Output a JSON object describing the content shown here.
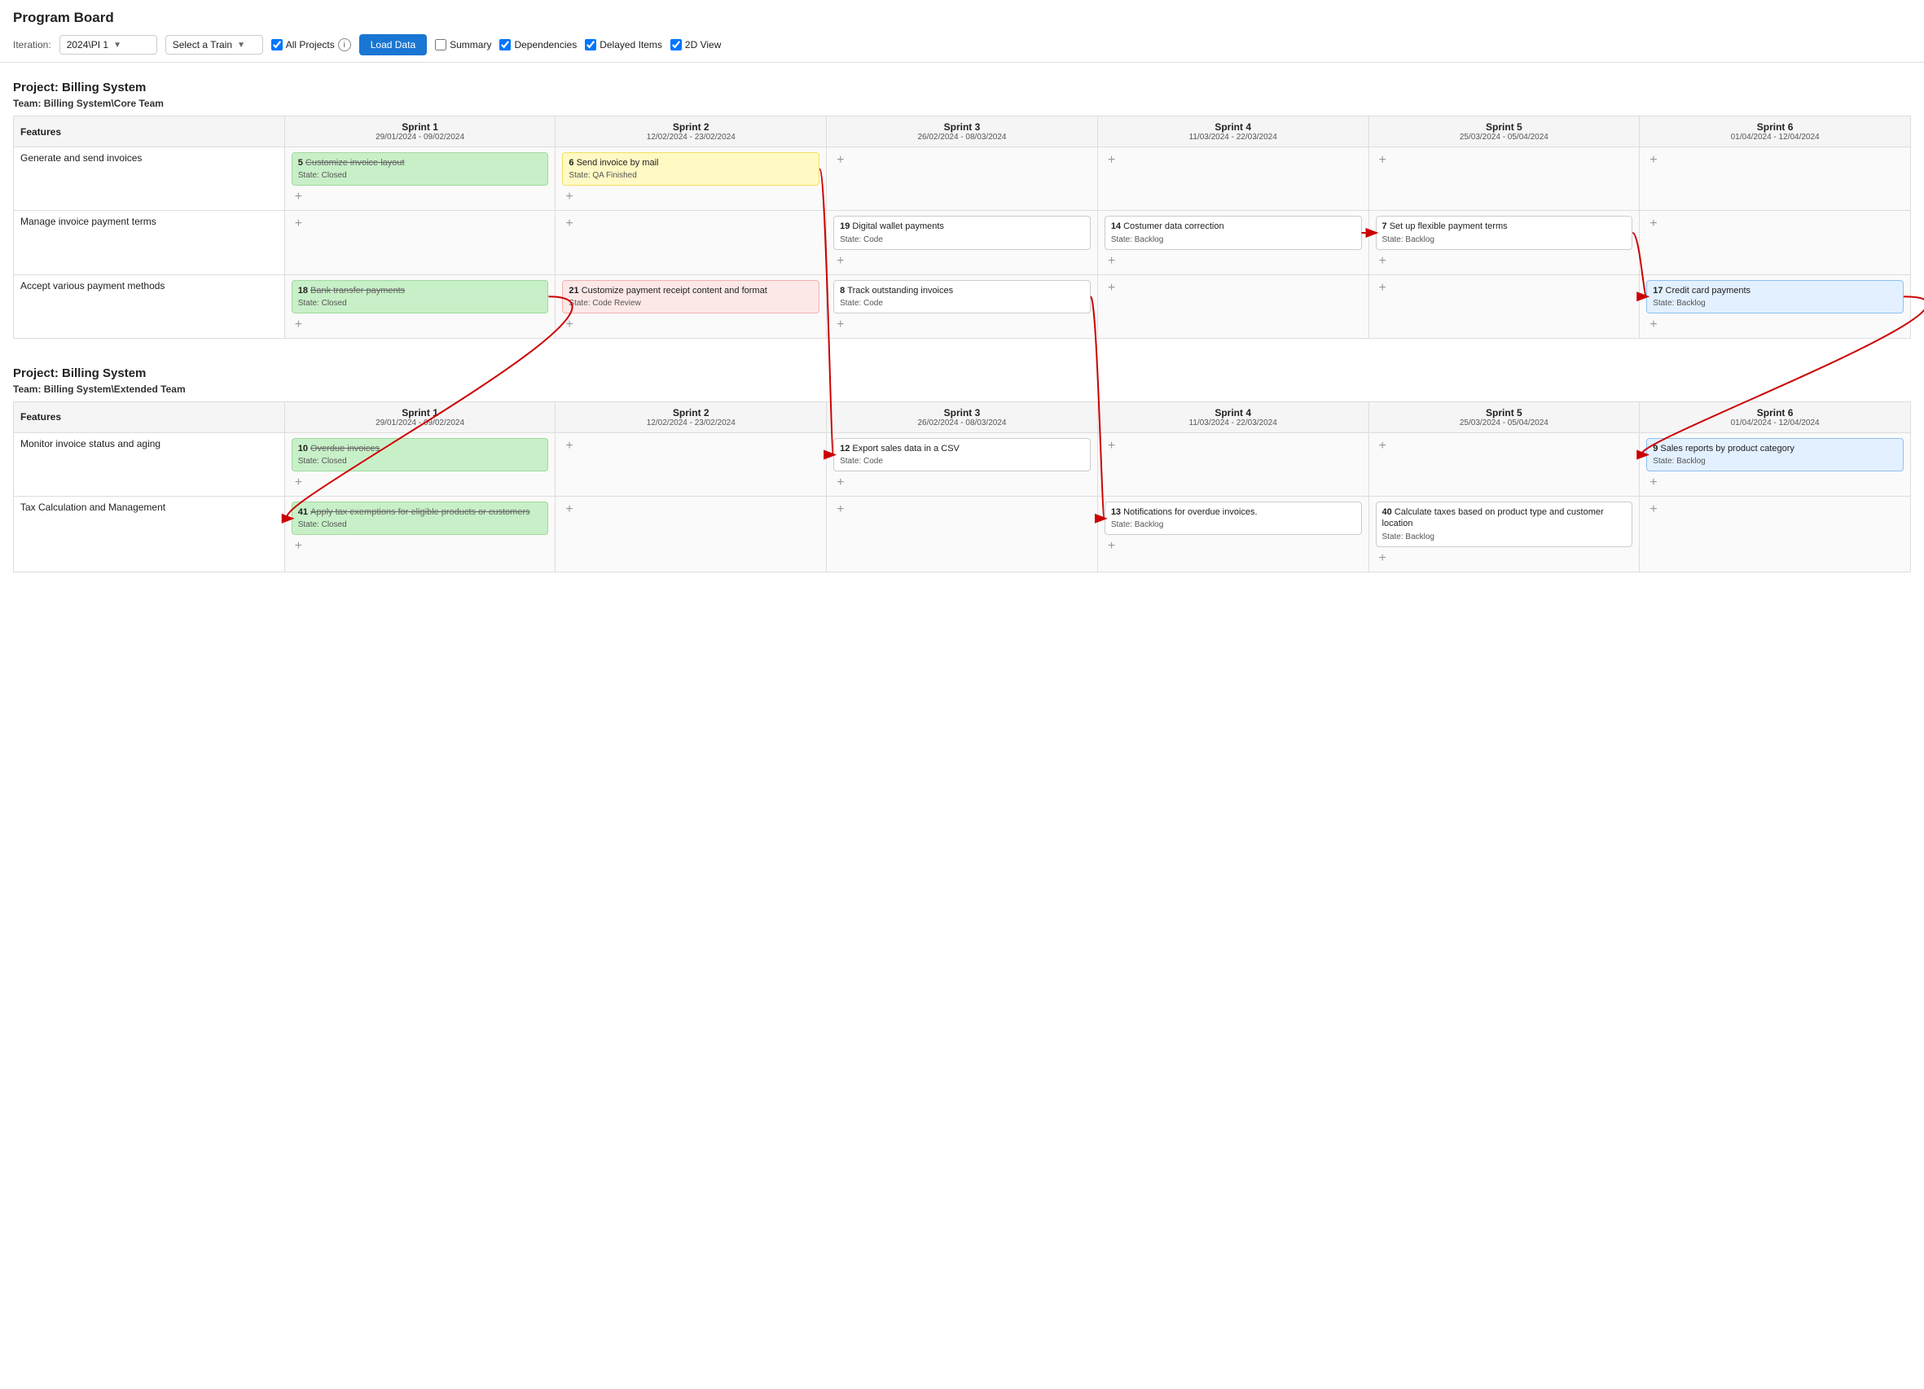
{
  "header": {
    "title": "Program Board",
    "iteration_label": "Iteration:",
    "iteration_value": "2024\\PI 1",
    "select_train_placeholder": "Select a Train",
    "all_projects_label": "All Projects",
    "load_data_label": "Load Data",
    "summary_label": "Summary",
    "dependencies_label": "Dependencies",
    "delayed_items_label": "Delayed Items",
    "two_d_view_label": "2D View"
  },
  "projects": [
    {
      "title": "Project: Billing System",
      "team": "Team: Billing System\\Core Team",
      "sprints": [
        {
          "name": "Sprint 1",
          "dates": "29/01/2024 - 09/02/2024"
        },
        {
          "name": "Sprint 2",
          "dates": "12/02/2024 - 23/02/2024"
        },
        {
          "name": "Sprint 3",
          "dates": "26/02/2024 - 08/03/2024"
        },
        {
          "name": "Sprint 4",
          "dates": "11/03/2024 - 22/03/2024"
        },
        {
          "name": "Sprint 5",
          "dates": "25/03/2024 - 05/04/2024"
        },
        {
          "name": "Sprint 6",
          "dates": "01/04/2024 - 12/04/2024"
        }
      ],
      "features": [
        {
          "name": "Generate and send invoices",
          "cards": [
            {
              "sprint": 0,
              "id": "5",
              "title": "Customize invoice layout",
              "state": "Closed",
              "color": "green",
              "strikethrough": true
            },
            {
              "sprint": 1,
              "id": "6",
              "title": "Send invoice by mail",
              "state": "QA Finished",
              "color": "yellow",
              "strikethrough": false
            }
          ]
        },
        {
          "name": "Manage invoice payment terms",
          "cards": [
            {
              "sprint": 2,
              "id": "19",
              "title": "Digital wallet payments",
              "state": "Code",
              "color": "white",
              "strikethrough": false
            },
            {
              "sprint": 3,
              "id": "14",
              "title": "Costumer data correction",
              "state": "Backlog",
              "color": "white",
              "strikethrough": false
            },
            {
              "sprint": 4,
              "id": "7",
              "title": "Set up flexible payment terms",
              "state": "Backlog",
              "color": "white",
              "strikethrough": false
            }
          ]
        },
        {
          "name": "Accept various payment methods",
          "cards": [
            {
              "sprint": 0,
              "id": "18",
              "title": "Bank transfer payments",
              "state": "Closed",
              "color": "green",
              "strikethrough": true
            },
            {
              "sprint": 1,
              "id": "21",
              "title": "Customize payment receipt content and format",
              "state": "Code Review",
              "color": "pink",
              "strikethrough": false
            },
            {
              "sprint": 2,
              "id": "8",
              "title": "Track outstanding invoices",
              "state": "Code",
              "color": "white",
              "strikethrough": false
            },
            {
              "sprint": 5,
              "id": "17",
              "title": "Credit card payments",
              "state": "Backlog",
              "color": "blue",
              "strikethrough": false
            }
          ]
        }
      ]
    },
    {
      "title": "Project: Billing System",
      "team": "Team: Billing System\\Extended Team",
      "sprints": [
        {
          "name": "Sprint 1",
          "dates": "29/01/2024 - 09/02/2024"
        },
        {
          "name": "Sprint 2",
          "dates": "12/02/2024 - 23/02/2024"
        },
        {
          "name": "Sprint 3",
          "dates": "26/02/2024 - 08/03/2024"
        },
        {
          "name": "Sprint 4",
          "dates": "11/03/2024 - 22/03/2024"
        },
        {
          "name": "Sprint 5",
          "dates": "25/03/2024 - 05/04/2024"
        },
        {
          "name": "Sprint 6",
          "dates": "01/04/2024 - 12/04/2024"
        }
      ],
      "features": [
        {
          "name": "Monitor invoice status and aging",
          "cards": [
            {
              "sprint": 0,
              "id": "10",
              "title": "Overdue invoices",
              "state": "Closed",
              "color": "green",
              "strikethrough": true
            },
            {
              "sprint": 2,
              "id": "12",
              "title": "Export sales data in a CSV",
              "state": "Code",
              "color": "white",
              "strikethrough": false
            },
            {
              "sprint": 5,
              "id": "9",
              "title": "Sales reports by product category",
              "state": "Backlog",
              "color": "blue",
              "strikethrough": false
            }
          ]
        },
        {
          "name": "Tax Calculation and Management",
          "cards": [
            {
              "sprint": 0,
              "id": "41",
              "title": "Apply tax exemptions for eligible products or customers",
              "state": "Closed",
              "color": "green",
              "strikethrough": true
            },
            {
              "sprint": 3,
              "id": "13",
              "title": "Notifications for overdue invoices.",
              "state": "Backlog",
              "color": "white",
              "strikethrough": false
            },
            {
              "sprint": 4,
              "id": "40",
              "title": "Calculate taxes based on product type and customer location",
              "state": "Backlog",
              "color": "white",
              "strikethrough": false
            }
          ]
        }
      ]
    }
  ]
}
